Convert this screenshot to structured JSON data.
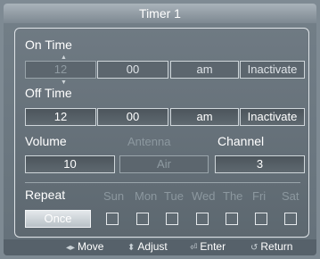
{
  "window": {
    "title": "Timer 1"
  },
  "on_time": {
    "label": "On Time",
    "hour": "12",
    "minute": "00",
    "ampm": "am",
    "activation": "Inactivate"
  },
  "off_time": {
    "label": "Off Time",
    "hour": "12",
    "minute": "00",
    "ampm": "am",
    "activation": "Inactivate"
  },
  "volume": {
    "label": "Volume",
    "value": "10"
  },
  "antenna": {
    "label": "Antenna",
    "value": "Air"
  },
  "channel": {
    "label": "Channel",
    "value": "3"
  },
  "repeat": {
    "label": "Repeat",
    "value": "Once",
    "days": [
      {
        "label": "Sun"
      },
      {
        "label": "Mon"
      },
      {
        "label": "Tue"
      },
      {
        "label": "Wed"
      },
      {
        "label": "The"
      },
      {
        "label": "Fri"
      },
      {
        "label": "Sat"
      }
    ]
  },
  "hints": {
    "move": "Move",
    "adjust": "Adjust",
    "enter": "Enter",
    "return": "Return"
  }
}
